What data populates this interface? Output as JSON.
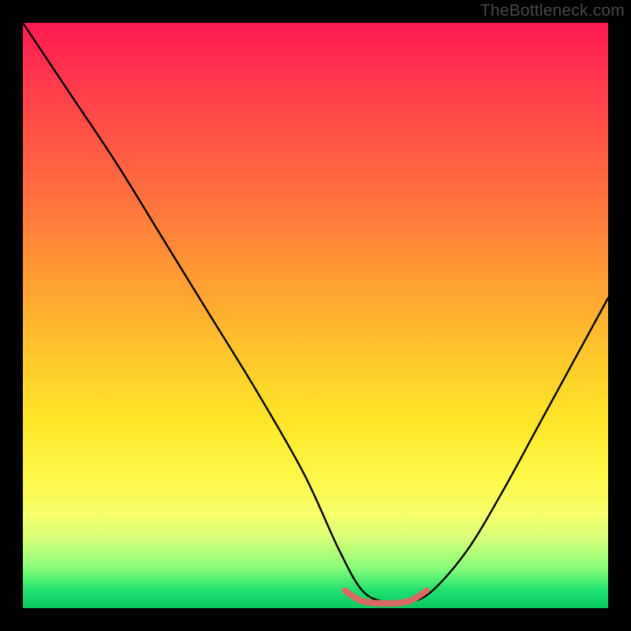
{
  "attribution": "TheBottleneck.com",
  "colors": {
    "background": "#000000",
    "gradient_top": "#ff1a52",
    "gradient_mid": "#ffe629",
    "gradient_bottom": "#08c85e",
    "curve": "#000000",
    "accent_segment": "#d96a63"
  },
  "chart_data": {
    "type": "line",
    "title": "",
    "xlabel": "",
    "ylabel": "",
    "xlim": [
      0,
      100
    ],
    "ylim": [
      0,
      100
    ],
    "series": [
      {
        "name": "bottleneck-curve",
        "x": [
          0,
          8,
          16,
          24,
          32,
          40,
          48,
          54,
          58,
          62,
          66,
          70,
          76,
          82,
          88,
          94,
          100
        ],
        "values": [
          100,
          88,
          76,
          63,
          50,
          37,
          23,
          10,
          3,
          1,
          1,
          3,
          10,
          20,
          31,
          42,
          53
        ]
      }
    ],
    "accent_segment": {
      "name": "flat-bottom",
      "x": [
        55,
        58,
        62,
        66,
        69
      ],
      "values": [
        3,
        1.2,
        0.8,
        1.2,
        3
      ]
    }
  }
}
